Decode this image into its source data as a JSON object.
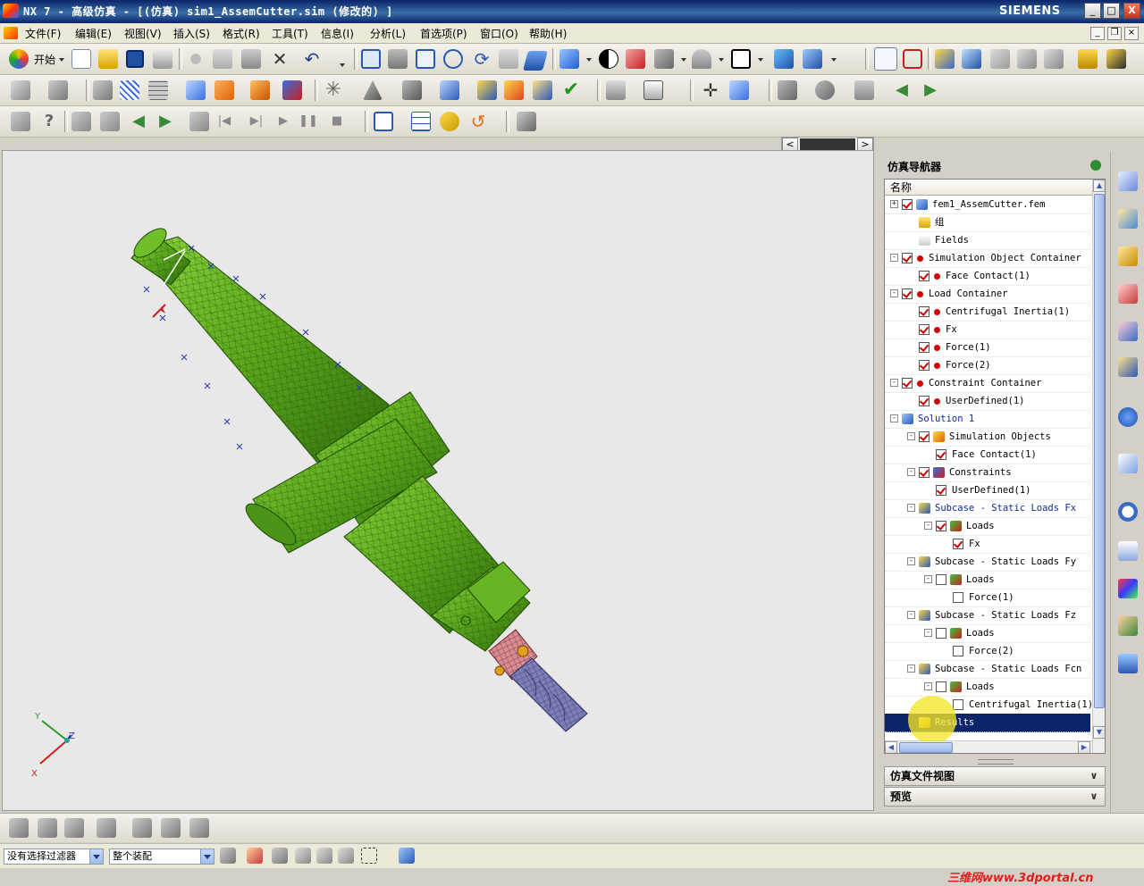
{
  "window": {
    "title": "NX 7 - 高级仿真 - [(仿真) sim1_AssemCutter.sim  (修改的) ]",
    "brand": "SIEMENS",
    "controls": [
      "_",
      "□",
      "X"
    ]
  },
  "menu": {
    "items": [
      "文件(F)",
      "编辑(E)",
      "视图(V)",
      "插入(S)",
      "格式(R)",
      "工具(T)",
      "信息(I)",
      "分析(L)",
      "首选项(P)",
      "窗口(O)",
      "帮助(H)"
    ]
  },
  "toolbar": {
    "start_label": "开始"
  },
  "navigator": {
    "title": "仿真导航器",
    "column_header": "名称",
    "rows": [
      {
        "label": "fem1_AssemCutter.fem",
        "indent": 0,
        "expander": "+",
        "check": true,
        "icon": "fem-icon"
      },
      {
        "label": "组",
        "indent": 1,
        "expander": "",
        "check": null,
        "icon": "folder-icon"
      },
      {
        "label": "Fields",
        "indent": 1,
        "expander": "",
        "check": null,
        "icon": "fields-icon"
      },
      {
        "label": "Simulation Object Container",
        "indent": 0,
        "expander": "-",
        "check": true,
        "icon": "red-dot"
      },
      {
        "label": "Face Contact(1)",
        "indent": 1,
        "expander": "",
        "check": true,
        "icon": "red-dot"
      },
      {
        "label": "Load Container",
        "indent": 0,
        "expander": "-",
        "check": true,
        "icon": "red-dot"
      },
      {
        "label": "Centrifugal Inertia(1)",
        "indent": 1,
        "expander": "",
        "check": true,
        "icon": "red-dot"
      },
      {
        "label": "Fx",
        "indent": 1,
        "expander": "",
        "check": true,
        "icon": "red-dot"
      },
      {
        "label": "Force(1)",
        "indent": 1,
        "expander": "",
        "check": true,
        "icon": "red-dot"
      },
      {
        "label": "Force(2)",
        "indent": 1,
        "expander": "",
        "check": true,
        "icon": "red-dot"
      },
      {
        "label": "Constraint Container",
        "indent": 0,
        "expander": "-",
        "check": true,
        "icon": "red-dot"
      },
      {
        "label": "UserDefined(1)",
        "indent": 1,
        "expander": "",
        "check": true,
        "icon": "red-dot"
      },
      {
        "label": "Solution 1",
        "indent": 0,
        "expander": "-",
        "check": null,
        "icon": "solution-icon",
        "blue": true
      },
      {
        "label": "Simulation Objects",
        "indent": 1,
        "expander": "-",
        "check": true,
        "icon": "sim-objects-icon"
      },
      {
        "label": "Face Contact(1)",
        "indent": 2,
        "expander": "",
        "check": true,
        "icon": ""
      },
      {
        "label": "Constraints",
        "indent": 1,
        "expander": "-",
        "check": true,
        "icon": "constraints-icon"
      },
      {
        "label": "UserDefined(1)",
        "indent": 2,
        "expander": "",
        "check": true,
        "icon": ""
      },
      {
        "label": "Subcase - Static Loads Fx",
        "indent": 1,
        "expander": "-",
        "check": null,
        "icon": "subcase-icon",
        "blue": true
      },
      {
        "label": "Loads",
        "indent": 2,
        "expander": "-",
        "check": true,
        "icon": "loads-icon"
      },
      {
        "label": "Fx",
        "indent": 3,
        "expander": "",
        "check": true,
        "icon": ""
      },
      {
        "label": "Subcase - Static Loads Fy",
        "indent": 1,
        "expander": "-",
        "check": null,
        "icon": "subcase-icon"
      },
      {
        "label": "Loads",
        "indent": 2,
        "expander": "-",
        "check": false,
        "icon": "loads-icon"
      },
      {
        "label": "Force(1)",
        "indent": 3,
        "expander": "",
        "check": false,
        "icon": ""
      },
      {
        "label": "Subcase - Static Loads Fz",
        "indent": 1,
        "expander": "-",
        "check": null,
        "icon": "subcase-icon"
      },
      {
        "label": "Loads",
        "indent": 2,
        "expander": "-",
        "check": false,
        "icon": "loads-icon"
      },
      {
        "label": "Force(2)",
        "indent": 3,
        "expander": "",
        "check": false,
        "icon": ""
      },
      {
        "label": "Subcase - Static Loads Fcn",
        "indent": 1,
        "expander": "-",
        "check": null,
        "icon": "subcase-icon"
      },
      {
        "label": "Loads",
        "indent": 2,
        "expander": "-",
        "check": false,
        "icon": "loads-icon"
      },
      {
        "label": "Centrifugal Inertia(1)",
        "indent": 3,
        "expander": "",
        "check": false,
        "icon": ""
      },
      {
        "label": "Results",
        "indent": 1,
        "expander": "",
        "check": null,
        "icon": "results-icon",
        "selected": true
      }
    ],
    "sections": [
      {
        "label": "仿真文件视图",
        "chevron": "∨"
      },
      {
        "label": "预览",
        "chevron": "∨"
      }
    ]
  },
  "viewport": {
    "triad_labels": {
      "x": "X",
      "y": "Y",
      "z": "Z"
    }
  },
  "statusbar": {
    "filter_value": "没有选择过滤器",
    "scope_value": "整个装配"
  },
  "watermark": "三维网www.3dportal.cn",
  "colors": {
    "accent": "#0a246a",
    "model_green": "#5aa51c",
    "tree_check": "#cc0000"
  }
}
